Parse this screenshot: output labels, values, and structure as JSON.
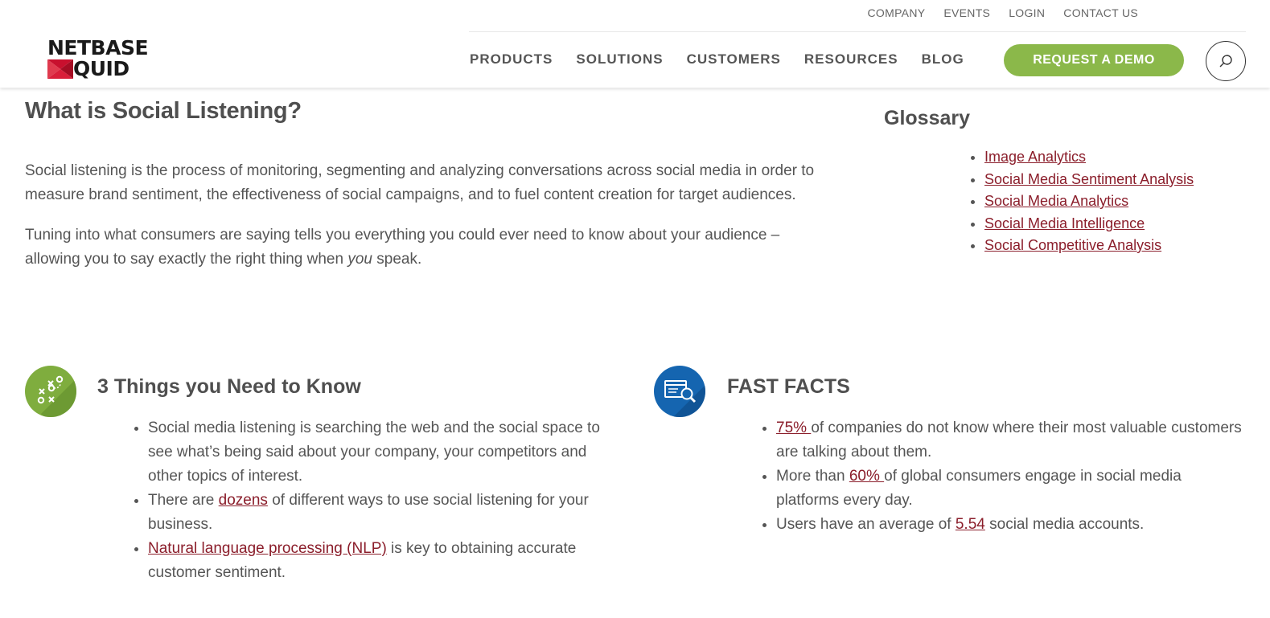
{
  "header": {
    "logo": {
      "line1": "NETBASE",
      "line2": "QUID"
    },
    "top_nav": [
      "COMPANY",
      "EVENTS",
      "LOGIN",
      "CONTACT US"
    ],
    "main_nav": [
      "PRODUCTS",
      "SOLUTIONS",
      "CUSTOMERS",
      "RESOURCES",
      "BLOG"
    ],
    "cta_label": "REQUEST A DEMO",
    "brand_green": "#8bb84a"
  },
  "main": {
    "title": "What is Social Listening?",
    "para1": "Social listening is the process of monitoring, segmenting and analyzing conversations across social media in order to measure brand sentiment, the effectiveness of social campaigns, and to fuel content creation for target audiences.",
    "para2_a": "Tuning into what consumers are saying tells you everything you could ever need to know about your audience – allowing you to say exactly the right thing when ",
    "para2_em": "you",
    "para2_b": " speak."
  },
  "glossary": {
    "title": "Glossary",
    "items": [
      "Image Analytics",
      "Social Media Sentiment Analysis",
      "Social Media Analytics",
      "Social Media Intelligence",
      "Social Competitive Analysis"
    ],
    "link_color": "#8b1e2b"
  },
  "section_things": {
    "title": "3 Things you Need to Know",
    "icon": "strategy-play-icon",
    "b1": "Social media listening is searching the web and the social space to see what’s being said about your company, your competitors and other topics of interest.",
    "b2_a": "There are ",
    "b2_link": "dozens",
    "b2_b": " of different ways to use social listening for your business.",
    "b3_link": "Natural language processing (NLP)",
    "b3_b": " is key to obtaining accurate customer sentiment."
  },
  "section_facts": {
    "title": "FAST FACTS",
    "icon": "report-search-icon",
    "f1_link": "75% ",
    "f1_b": "of companies do not know where their most valuable customers are talking about them.",
    "f2_a": "More than ",
    "f2_link": "60% ",
    "f2_b": "of global consumers engage in social media platforms every day.",
    "f3_a": "Users have an average of ",
    "f3_link": "5.54",
    "f3_b": " social media accounts."
  }
}
